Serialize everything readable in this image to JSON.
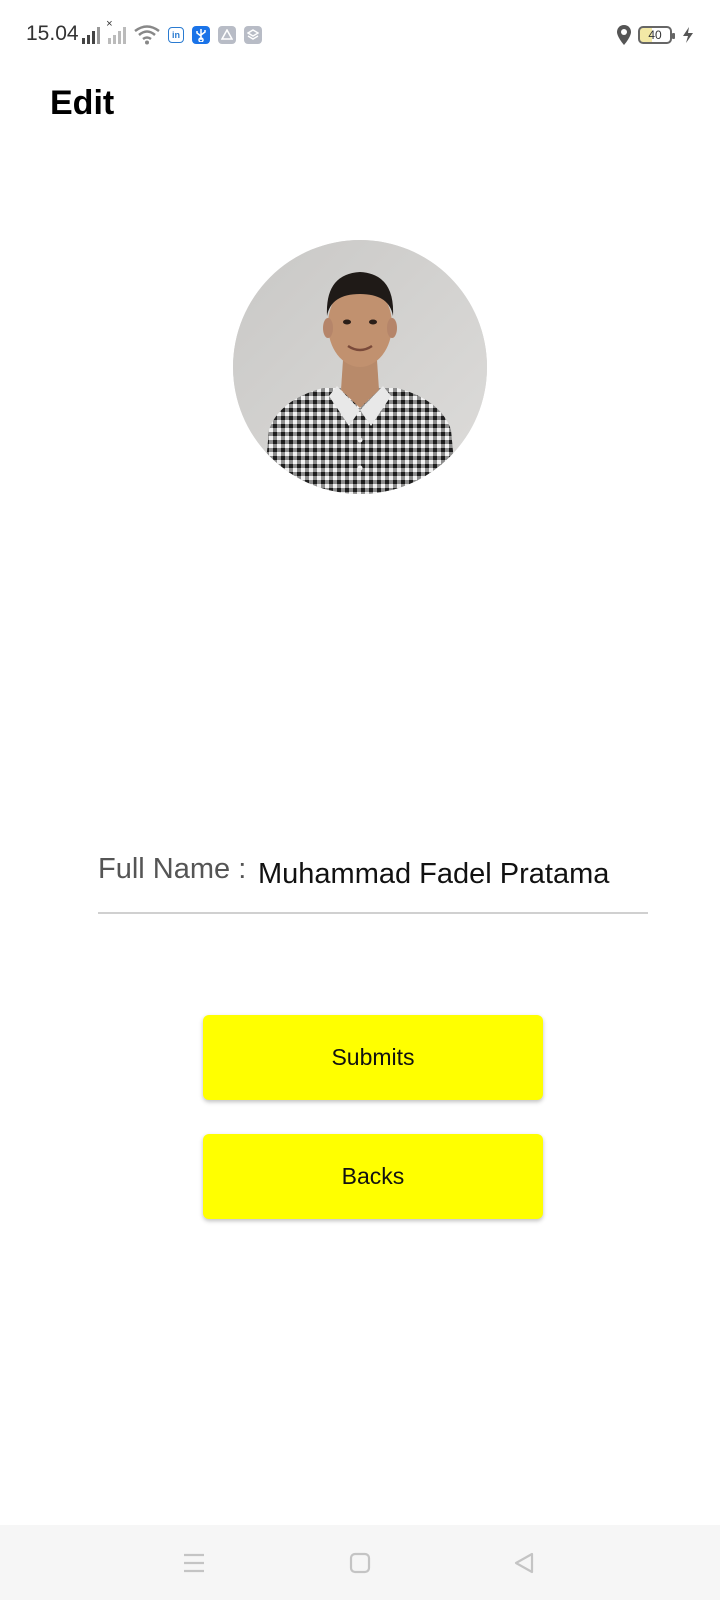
{
  "status_bar": {
    "time": "15.04",
    "battery_level": "40",
    "app_badges": [
      "in"
    ]
  },
  "page": {
    "title": "Edit"
  },
  "form": {
    "full_name_label": "Full Name :",
    "full_name_value": "Muhammad Fadel Pratama"
  },
  "buttons": {
    "submit_label": "Submits",
    "back_label": "Backs"
  },
  "colors": {
    "button_bg": "#ffff00",
    "background": "#ffffff",
    "nav_bar_bg": "#f6f6f6"
  },
  "icons": {
    "status_left": [
      "signal-icon",
      "signal-no-service-icon",
      "wifi-icon",
      "linkedin-icon",
      "usb-icon",
      "drive-icon",
      "stack-icon"
    ],
    "status_right": [
      "location-icon",
      "battery-icon",
      "charging-icon"
    ],
    "nav": [
      "menu-icon",
      "home-icon",
      "back-icon"
    ]
  }
}
